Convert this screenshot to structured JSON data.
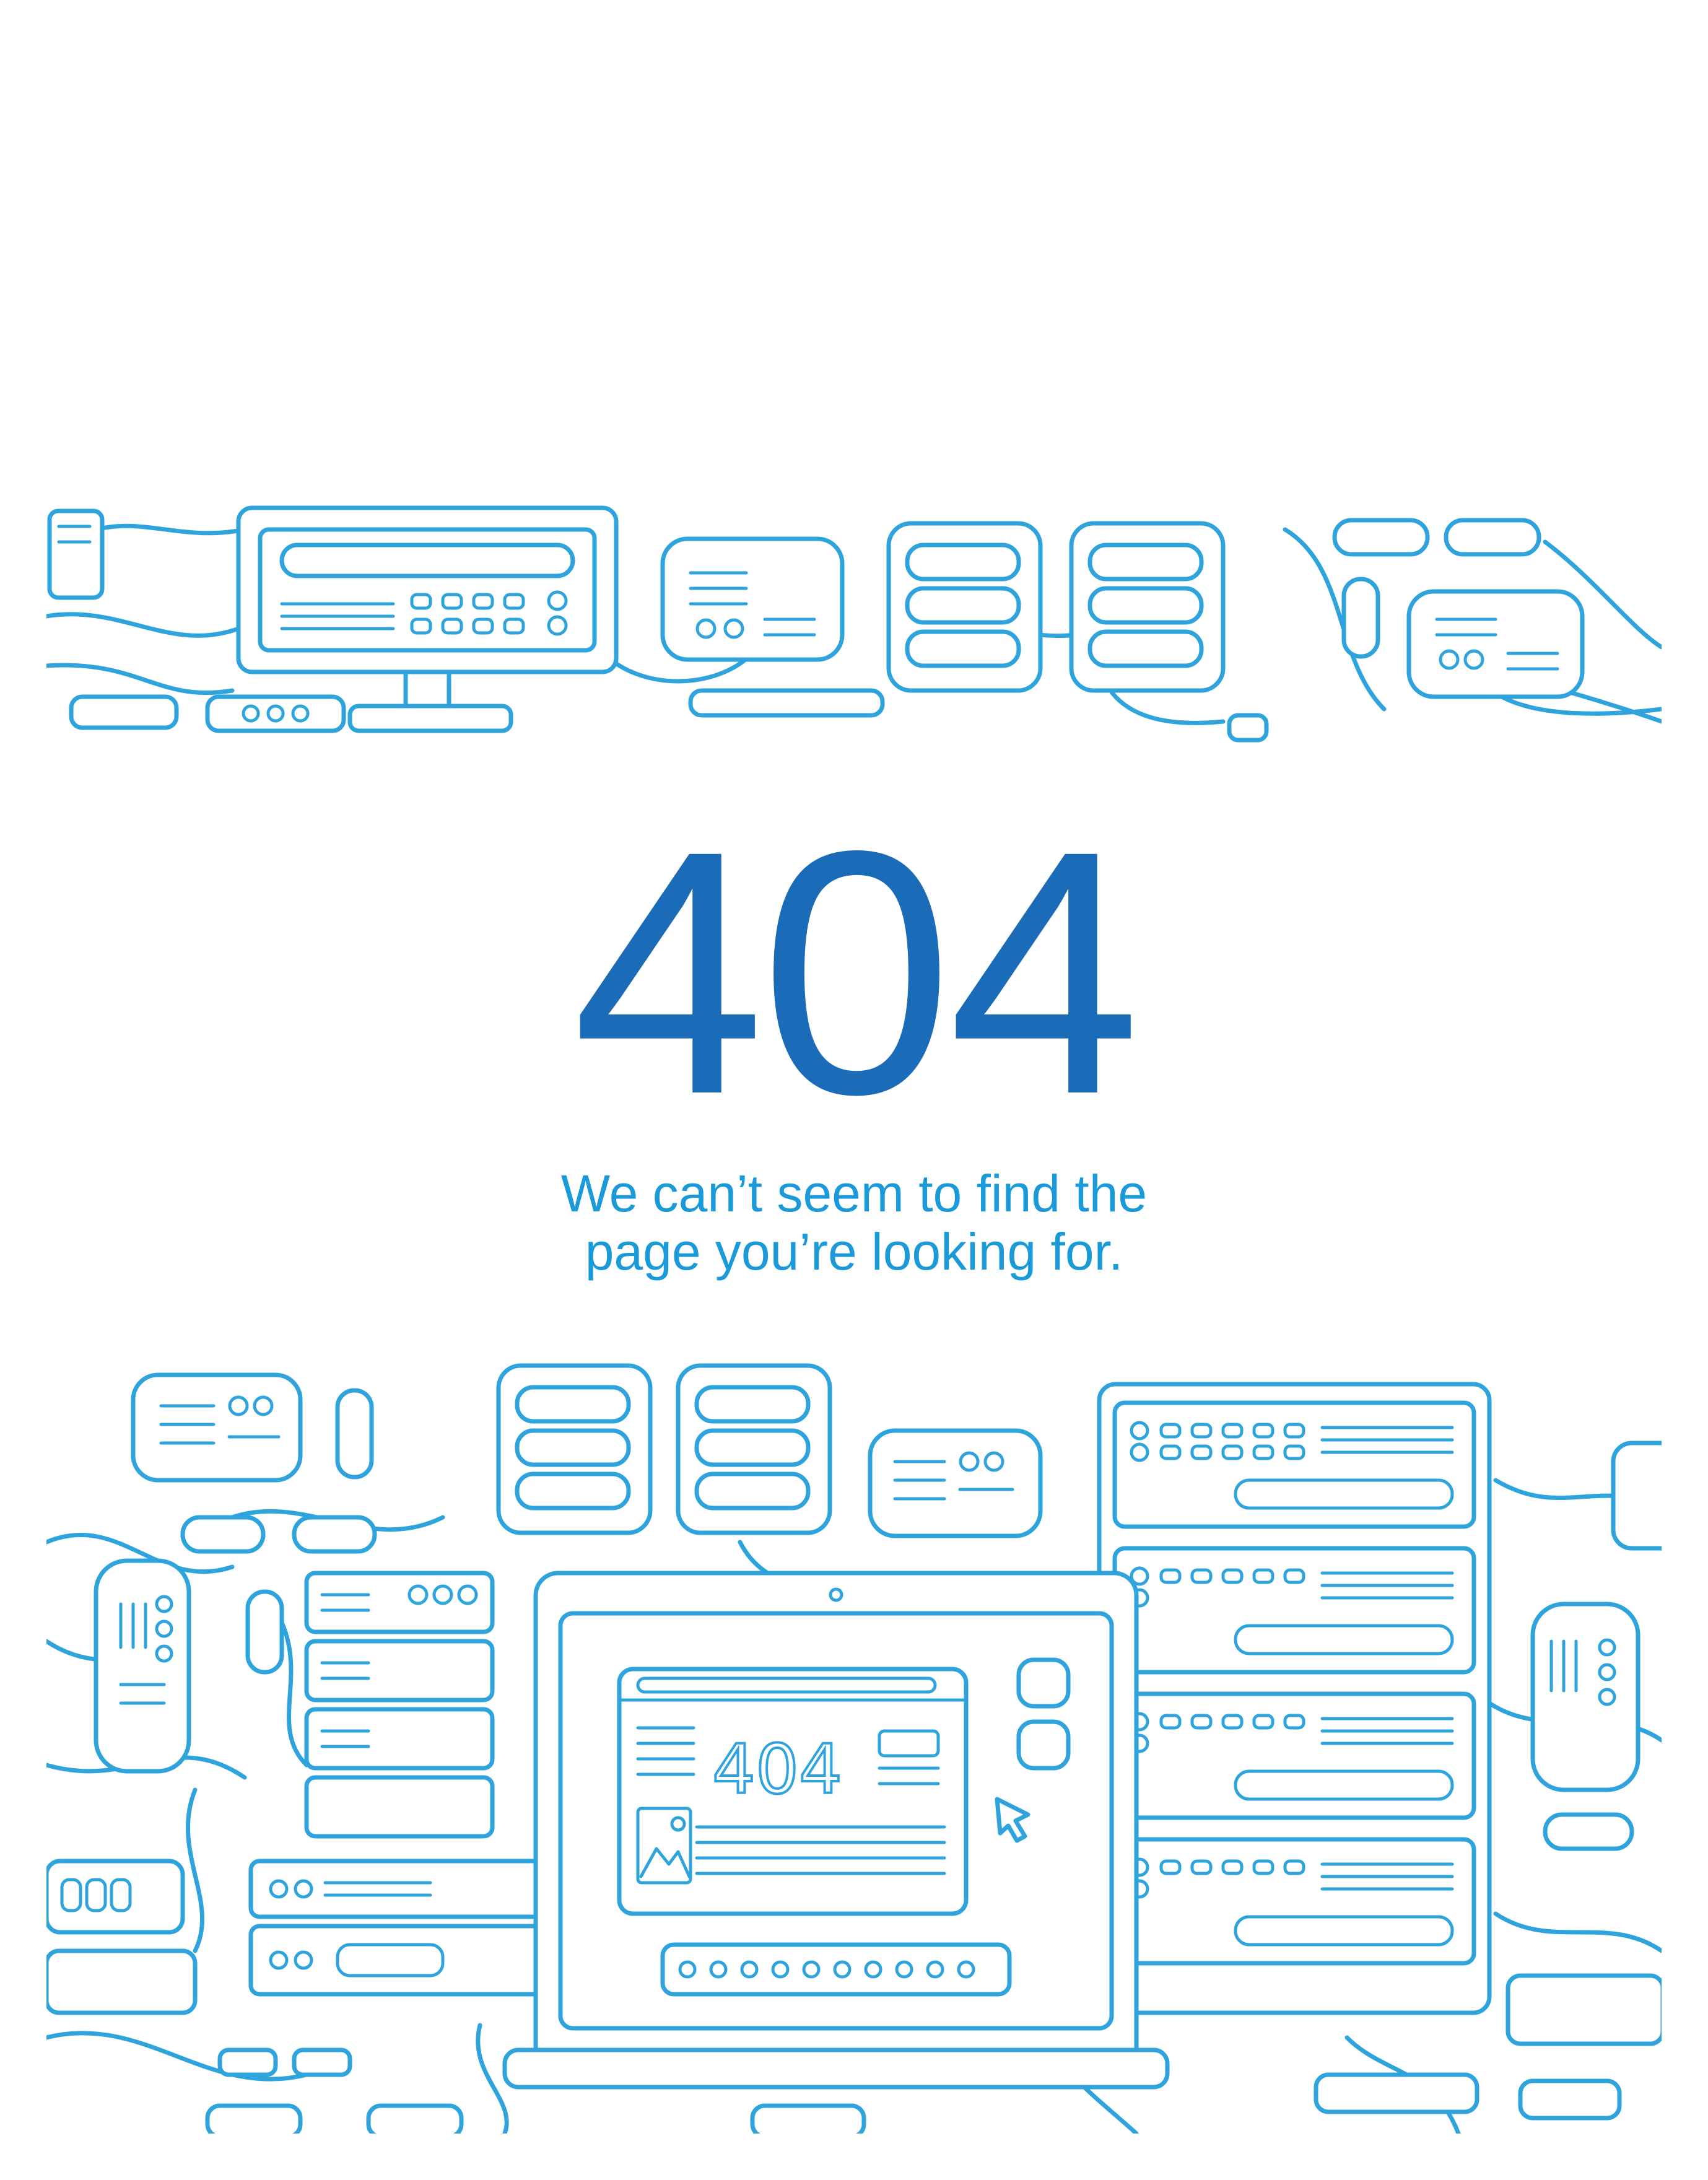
{
  "error": {
    "code": "404",
    "message_line1": "We can’t seem to find the",
    "message_line2": "page you’re looking for."
  },
  "illustration": {
    "screen_text": "404",
    "icons": [
      "server-rack-icon",
      "laptop-icon",
      "router-icon",
      "network-cable-icon",
      "cursor-icon",
      "image-icon"
    ]
  },
  "colors": {
    "heading": "#1a6bb8",
    "message": "#1a9ad8",
    "line_art": "#2fa4dc",
    "background": "#ffffff"
  }
}
